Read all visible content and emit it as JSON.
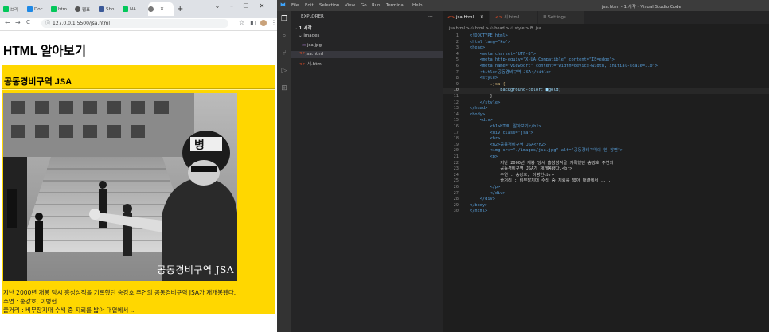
{
  "browser": {
    "tabs": [
      "브라",
      "Doc",
      "htm",
      "웹표",
      "Sho",
      "NA",
      "",
      ""
    ],
    "new_tab": "+",
    "url": "127.0.0.1:5500/jsa.html",
    "window_controls": [
      "⌄",
      "–",
      "☐",
      "✕"
    ],
    "nav": {
      "back": "←",
      "forward": "→",
      "reload": "C",
      "info": "ⓘ"
    }
  },
  "page": {
    "h1": "HTML 알아보기",
    "h2": "공동경비구역 JSA",
    "poster_title": "공동경비구역 JSA",
    "poster_alt": "공동경비구역의 한 장면",
    "paragraph_lines": [
      "지난 2000년 개봉 당시 흥성성적을 기록했던 송강호 주연의 공동경비구역 JSA가 재개봉됐다.",
      "주연 : 송강호, 이병헌",
      "줄거리 : 비무장지대 수색 중 지뢰를 밟아 대열에서 ..."
    ]
  },
  "vscode": {
    "window_title": "jsa.html - 1.시작 - Visual Studio Code",
    "menu": [
      "File",
      "Edit",
      "Selection",
      "View",
      "Go",
      "Run",
      "Terminal",
      "Help"
    ],
    "explorer_label": "EXPLORER",
    "explorer_more": "...",
    "tree": [
      {
        "label": "1.시작",
        "kind": "folder"
      },
      {
        "label": "images",
        "kind": "folder"
      },
      {
        "label": "jsa.jpg",
        "kind": "image"
      },
      {
        "label": "jsa.html",
        "kind": "html"
      },
      {
        "label": "시.html",
        "kind": "html"
      }
    ],
    "editor_tabs": [
      "jsa.html",
      "시.html",
      "Settings"
    ],
    "close_glyph": "✕",
    "breadcrumb": "jsa.html > ⟐ html > ⟐ head > ⟐ style > ⧉ .jsa",
    "accent": "#007acc",
    "code_lines": [
      [
        "t",
        "<!DOCTYPE html>"
      ],
      [
        "t",
        "<html lang=\"ko\">"
      ],
      [
        "t",
        "<head>"
      ],
      [
        "t",
        "    <meta charset=\"UTF-8\">"
      ],
      [
        "t",
        "    <meta http-equiv=\"X-UA-Compatible\" content=\"IE=edge\">"
      ],
      [
        "t",
        "    <meta name=\"viewport\" content=\"width=device-width, initial-scale=1.0\">"
      ],
      [
        "t",
        "    <title>공동경비구역 JSA</title>"
      ],
      [
        "t",
        "    <style>"
      ],
      [
        "c",
        "        .jsa {"
      ],
      [
        "a",
        "            background-color: ■gold;"
      ],
      [
        "w",
        "        }"
      ],
      [
        "t",
        "    </style>"
      ],
      [
        "t",
        "</head>"
      ],
      [
        "t",
        "<body>"
      ],
      [
        "t",
        "    <div>"
      ],
      [
        "t",
        "        <h1>HTML 알아보기</h1>"
      ],
      [
        "t",
        "        <div class=\"jsa\">"
      ],
      [
        "t",
        "        <hr>"
      ],
      [
        "t",
        "        <h2>공동경비구역 JSA</h2>"
      ],
      [
        "t",
        "        <img src=\"./images/jsa.jpg\" alt=\"공동경비구역의 한 장면\">"
      ],
      [
        "t",
        "        <p>"
      ],
      [
        "w",
        "            지난 2000년 개봉 당시 흥성성적을 기록했던 송강호 주연의"
      ],
      [
        "w",
        "            공동경비구역 JSA가 재개봉됐다.<br>"
      ],
      [
        "w",
        "            주연 : 송강호, 이병헌<br>"
      ],
      [
        "w",
        "            줄거리 : 비무장지대 수색 중 지뢰를 밟아 대열에서 ...."
      ],
      [
        "t",
        "        </p>"
      ],
      [
        "t",
        "        </div>"
      ],
      [
        "t",
        "    </div>"
      ],
      [
        "t",
        "</body>"
      ],
      [
        "t",
        "</html>"
      ]
    ]
  }
}
